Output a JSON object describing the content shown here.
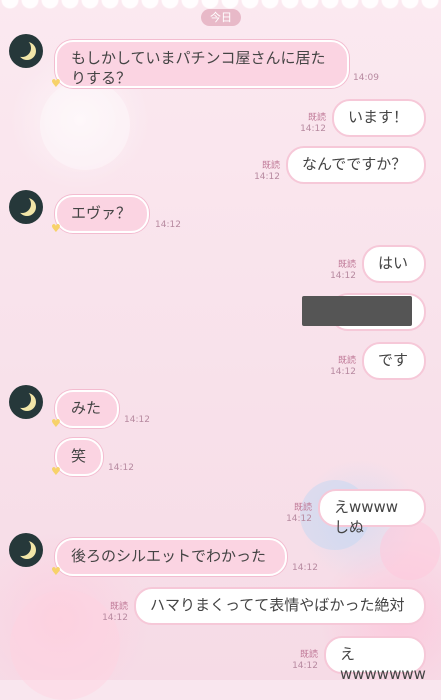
{
  "header": {
    "date_label": "今日"
  },
  "messages": [
    {
      "text": "もしかしていまパチンコ屋さんに居たりする？",
      "line1": "もしかしていまパチンコ屋さんに居た",
      "line2": "りする？",
      "time": "14:09"
    },
    {
      "text": "います！",
      "read": "既読",
      "time": "14:12"
    },
    {
      "text": "なんでですか？",
      "read": "既読",
      "time": "14:12"
    },
    {
      "text": "エヴァ？",
      "time": "14:12"
    },
    {
      "text": "はい",
      "read": "既読",
      "time": "14:12"
    },
    {
      "text": "",
      "redacted": true
    },
    {
      "text": "です",
      "read": "既読",
      "time": "14:12"
    },
    {
      "text": "みた",
      "time": "14:12"
    },
    {
      "text": "笑",
      "time": "14:12"
    },
    {
      "text": "えwwwwしぬ",
      "read": "既読",
      "time": "14:12"
    },
    {
      "text": "後ろのシルエットでわかった",
      "time": "14:12"
    },
    {
      "text": "ハマりまくってて表情やばかった絶対",
      "read": "既読",
      "time": "14:12"
    },
    {
      "text": "えwwwwwww",
      "read": "既読",
      "time": "14:12"
    }
  ]
}
